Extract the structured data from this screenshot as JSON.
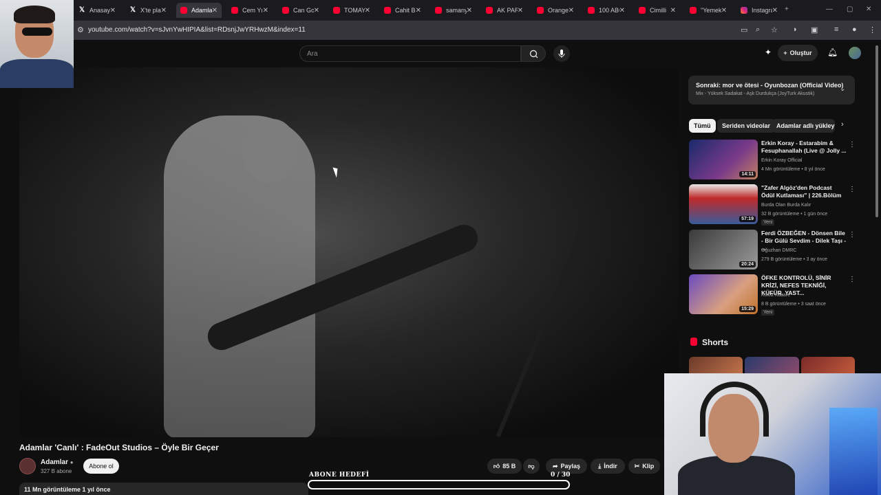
{
  "browser": {
    "tabs": [
      {
        "label": "Anasayfa",
        "icon": "x"
      },
      {
        "label": "X'te playlist",
        "icon": "x"
      },
      {
        "label": "Adamlar",
        "icon": "yt",
        "active": true
      },
      {
        "label": "Cem Yılmaz",
        "icon": "yt"
      },
      {
        "label": "Can Gox",
        "icon": "yt"
      },
      {
        "label": "TOMAY",
        "icon": "yt"
      },
      {
        "label": "Cahit Berkay",
        "icon": "yt"
      },
      {
        "label": "samanyolu",
        "icon": "yt"
      },
      {
        "label": "AK PARTİ",
        "icon": "yt"
      },
      {
        "label": "Orange",
        "icon": "yt"
      },
      {
        "label": "100 ABONE",
        "icon": "yt"
      },
      {
        "label": "Cimilli",
        "icon": "yt"
      },
      {
        "label": "\"Yemek",
        "icon": "yt"
      },
      {
        "label": "Instagram",
        "icon": "ig"
      }
    ],
    "url": "youtube.com/watch?v=sJvnYwHIPIA&list=RDsnjJwYRHwzM&index=11"
  },
  "header": {
    "search_placeholder": "Ara",
    "create_label": "Oluştur"
  },
  "video": {
    "title": "Adamlar 'Canlı' : FadeOut Studios – Öyle Bir Geçer",
    "channel": "Adamlar",
    "subscribers": "327 B abone",
    "subscribe_label": "Abone ol",
    "likes": "85 B",
    "share_label": "Paylaş",
    "download_label": "İndir",
    "clip_label": "Klip",
    "stats": "11 Mn görüntüleme  1 yıl önce"
  },
  "overlay": {
    "goal_label": "ABONE HEDEFİ",
    "goal_current": "0",
    "goal_target": "/ 30",
    "goal_progress": 0
  },
  "sidebar": {
    "upnext_title": "Sonraki: mor ve ötesi - Oyunbozan (Official Video)",
    "upnext_sub": "Mix - Yüksek Sadakat - Aşk Durdukça (JoyTurk Akustik)",
    "chips": [
      "Tümü",
      "Seriden videolar",
      "Adamlar adlı yükleyici"
    ],
    "recommendations": [
      {
        "title": "Erkin Koray - Estarabim & Fesuphanallah (Live @ Jolly ...",
        "channel": "Erkin Koray Official",
        "meta": "4 Mn görüntüleme • 8 yıl önce",
        "duration": "14:11",
        "new": ""
      },
      {
        "title": "\"Zafer Algöz'den Podcast Ödül Kutlaması\" | 226.Bölüm",
        "channel": "Burda Olan Burda Kalır",
        "meta": "32 B görüntüleme • 1 gün önce",
        "duration": "57:19",
        "new": "Yeni"
      },
      {
        "title": "Ferdi ÖZBEĞEN - Dönsen Bile - Bir Gülü Sevdim - Dilek Taşı - ...",
        "channel": "Oğuzhan DMRC",
        "meta": "279 B görüntüleme • 3 ay önce",
        "duration": "20:24",
        "new": ""
      },
      {
        "title": "ÖFKE KONTROLÜ, SİNİR KRİZİ, NEFES TEKNİĞİ, KÜFÜR, YAST...",
        "channel": "Kukla Kabare",
        "meta": "8 B görüntüleme • 3 saat önce",
        "duration": "15:29",
        "new": "Yeni"
      }
    ],
    "shorts_title": "Shorts"
  },
  "colors": {
    "accent": "#ff0033",
    "bg": "#0f0f0f"
  }
}
